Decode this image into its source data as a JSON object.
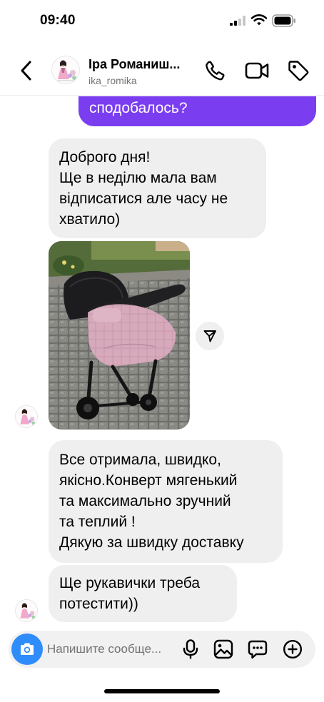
{
  "status_bar": {
    "time": "09:40"
  },
  "header": {
    "contact_name": "Іра Романиш...",
    "username": "ika_romika",
    "icons": [
      "back-icon",
      "phone-icon",
      "video-camera-icon",
      "tag-icon"
    ]
  },
  "messages": {
    "outgoing_partial": "сподобалось?",
    "incoming": [
      {
        "lines": [
          "Доброго дня!",
          "Ще в неділю мала вам",
          "відписатися але часу не",
          "хватило)"
        ]
      },
      {
        "lines": [
          "Все отримала, швидко,",
          "якісно.Конверт мягенький",
          "та максимально зручний",
          "та теплий !",
          "Дякую за швидку доставку"
        ]
      },
      {
        "lines": [
          "Ще рукавички треба",
          "потестити))"
        ]
      }
    ],
    "photo_icon": "share-icon"
  },
  "composer": {
    "placeholder": "Напишите сообще...",
    "icons": [
      "camera-icon",
      "mic-icon",
      "gallery-icon",
      "sticker-icon",
      "plus-icon"
    ]
  },
  "colors": {
    "outgoing_bubble": "#7b3df0",
    "incoming_bubble": "#efefef",
    "camera_button": "#2f8dfb"
  }
}
